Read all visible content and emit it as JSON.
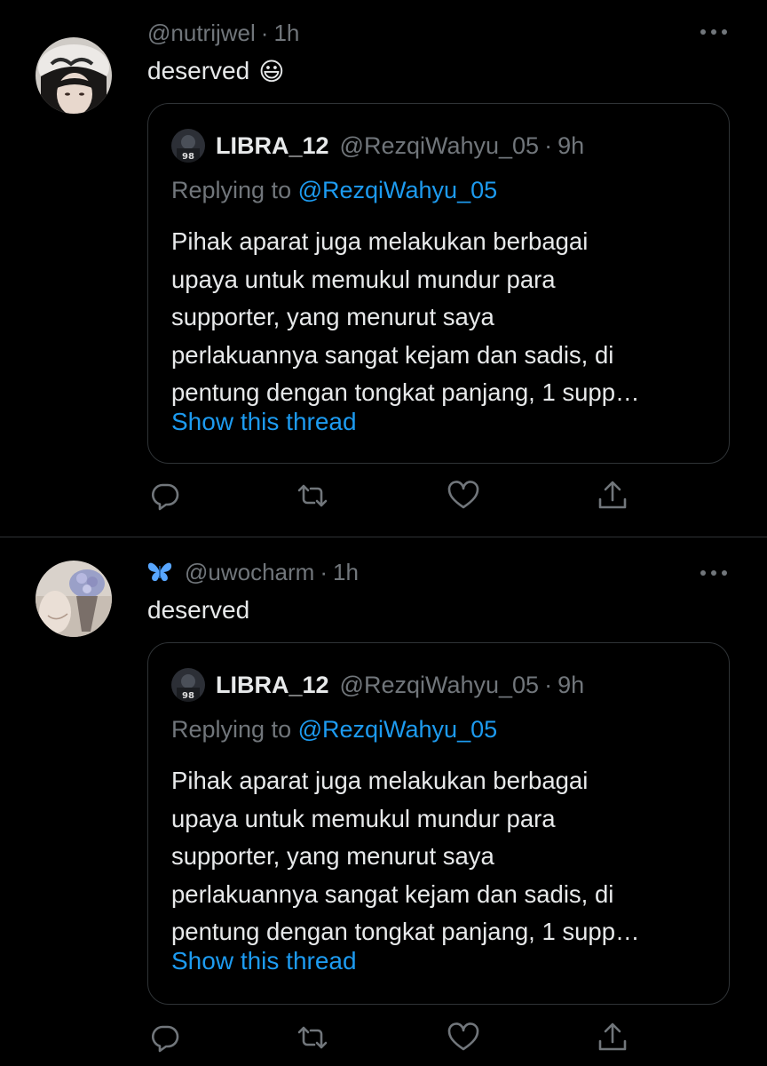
{
  "tweets": [
    {
      "handle": "@nutrijwel",
      "sep": "·",
      "time": "1h",
      "text": "deserved",
      "emoji": "😃",
      "quote": {
        "name": "LIBRA_12",
        "handle": "@RezqiWahyu_05",
        "sep": "·",
        "time": "9h",
        "replying_prefix": "Replying to",
        "replying_to": "@RezqiWahyu_05",
        "text": "Pihak aparat juga melakukan berbagai\nupaya untuk memukul mundur para\nsupporter, yang menurut saya\nperlakuannya sangat kejam dan sadis, di\npentung dengan tongkat panjang, 1 supp…",
        "show_thread": "Show this thread"
      },
      "icons": [
        "reply-icon",
        "retweet-icon",
        "like-icon",
        "share-icon"
      ]
    },
    {
      "handle": "@uwocharm",
      "sep": "·",
      "time": "1h",
      "text": "deserved",
      "badge_icon": "butterfly-icon",
      "quote": {
        "name": "LIBRA_12",
        "handle": "@RezqiWahyu_05",
        "sep": "·",
        "time": "9h",
        "replying_prefix": "Replying to",
        "replying_to": "@RezqiWahyu_05",
        "text": "Pihak aparat juga melakukan berbagai\nupaya untuk memukul mundur para\nsupporter, yang menurut saya\nperlakuannya sangat kejam dan sadis, di\npentung dengan tongkat panjang, 1 supp…",
        "show_thread": "Show this thread"
      },
      "icons": [
        "reply-icon",
        "retweet-icon",
        "like-icon",
        "share-icon"
      ]
    }
  ],
  "colors": {
    "background": "#000000",
    "text": "#e7e9ea",
    "muted": "#71767b",
    "link": "#1d9bf0",
    "border": "#2f3336",
    "butterfly": "#58a6ff"
  }
}
